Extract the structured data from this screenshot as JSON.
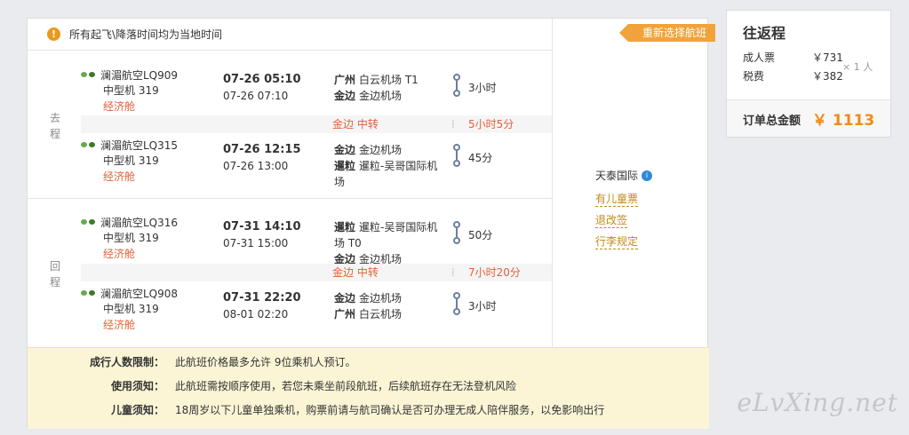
{
  "notice": "所有起飞\\降落时间均为当地时间",
  "outbound": {
    "label": "去程",
    "flights": [
      {
        "airline": "澜湄航空LQ909",
        "plane": "中型机 319",
        "cabin": "经济舱",
        "dep_time": "07-26 05:10",
        "arr_time": "07-26 07:10",
        "dep_city": "广州",
        "dep_airport": "白云机场 T1",
        "arr_city": "金边",
        "arr_airport": "金边机场",
        "duration": "3小时"
      },
      {
        "airline": "澜湄航空LQ315",
        "plane": "中型机 319",
        "cabin": "经济舱",
        "dep_time": "07-26 12:15",
        "arr_time": "07-26 13:00",
        "dep_city": "金边",
        "dep_airport": "金边机场",
        "arr_city": "暹粒",
        "arr_airport": "暹粒-吴哥国际机场",
        "duration": "45分"
      }
    ],
    "transfer": {
      "city": "金边 中转",
      "duration": "5小时5分"
    }
  },
  "return": {
    "label": "回程",
    "flights": [
      {
        "airline": "澜湄航空LQ316",
        "plane": "中型机 319",
        "cabin": "经济舱",
        "dep_time": "07-31 14:10",
        "arr_time": "07-31 15:00",
        "dep_city": "暹粒",
        "dep_airport": "暹粒-吴哥国际机场 T0",
        "arr_city": "金边",
        "arr_airport": "金边机场",
        "duration": "50分"
      },
      {
        "airline": "澜湄航空LQ908",
        "plane": "中型机 319",
        "cabin": "经济舱",
        "dep_time": "07-31 22:20",
        "arr_time": "08-01 02:20",
        "dep_city": "金边",
        "dep_airport": "金边机场",
        "arr_city": "广州",
        "arr_airport": "白云机场",
        "duration": "3小时"
      }
    ],
    "transfer": {
      "city": "金边 中转",
      "duration": "7小时20分"
    }
  },
  "side": {
    "reselect": "重新选择航班",
    "vendor": "天泰国际",
    "vendor_badge": "i",
    "links": [
      "有儿童票",
      "退改签",
      "行李规定"
    ]
  },
  "rules": [
    {
      "key": "成行人数限制：",
      "value": "此航班价格最多允许 9位乘机人预订。"
    },
    {
      "key": "使用须知：",
      "value": "此航班需按顺序使用，若您未乘坐前段航班，后续航班存在无法登机风险"
    },
    {
      "key": "儿童须知：",
      "value": "18周岁以下儿童单独乘机，购票前请与航司确认是否可办理无成人陪伴服务，以免影响出行"
    }
  ],
  "summary": {
    "title": "往返程",
    "adult_label": "成人票",
    "adult_price": "￥731",
    "tax_label": "税费",
    "tax_price": "￥382",
    "multiplier": "× 1 人",
    "total_label": "订单总金额",
    "total_amount": "￥ 1113"
  },
  "watermark": "eLvXing.net",
  "colors": {
    "accent": "#f08a17",
    "cabin": "#e0623a",
    "link": "#c08b1a",
    "rules_bg": "#fbf5d6",
    "reselect": "#f0a33a"
  }
}
